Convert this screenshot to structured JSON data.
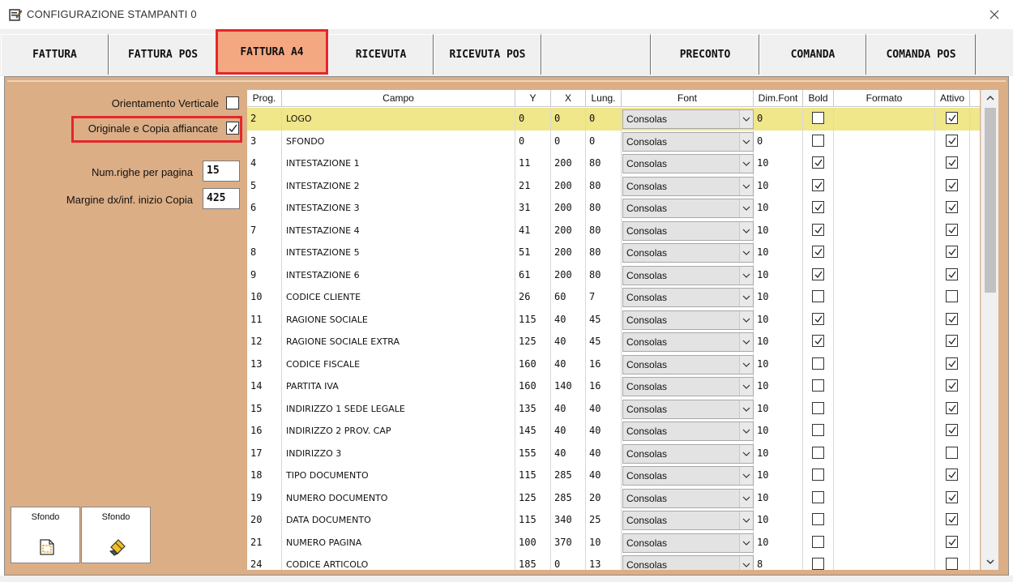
{
  "window": {
    "title": "CONFIGURAZIONE STAMPANTI 0"
  },
  "tabs": [
    {
      "label": "FATTURA"
    },
    {
      "label": "FATTURA POS"
    },
    {
      "label": "FATTURA A4",
      "active": true
    },
    {
      "label": "RICEVUTA"
    },
    {
      "label": "RICEVUTA POS"
    },
    {
      "label": ""
    },
    {
      "label": "PRECONTO"
    },
    {
      "label": "COMANDA"
    },
    {
      "label": "COMANDA POS"
    }
  ],
  "options": {
    "orientamento_label": "Orientamento Verticale",
    "orientamento_checked": false,
    "affiancate_label": "Originale e Copia affiancate",
    "affiancate_checked": true,
    "righe_label": "Num.righe per pagina",
    "righe_value": "15",
    "margine_label": "Margine dx/inf. inizio Copia",
    "margine_value": "425"
  },
  "buttons": {
    "sfondo1_label": "Sfondo",
    "sfondo2_label": "Sfondo"
  },
  "grid": {
    "headers": [
      "Prog.",
      "Campo",
      "Y",
      "X",
      "Lung.",
      "Font",
      "Dim.Font",
      "Bold",
      "Formato",
      "Attivo"
    ],
    "rows": [
      {
        "prog": "2",
        "campo": "LOGO",
        "y": "0",
        "x": "0",
        "lung": "0",
        "font": "Consolas",
        "dim": "0",
        "bold": false,
        "formato": "",
        "attivo": true,
        "selected": true
      },
      {
        "prog": "3",
        "campo": "SFONDO",
        "y": "0",
        "x": "0",
        "lung": "0",
        "font": "Consolas",
        "dim": "0",
        "bold": false,
        "formato": "",
        "attivo": true
      },
      {
        "prog": "4",
        "campo": "INTESTAZIONE 1",
        "y": "11",
        "x": "200",
        "lung": "80",
        "font": "Consolas",
        "dim": "10",
        "bold": true,
        "formato": "",
        "attivo": true
      },
      {
        "prog": "5",
        "campo": "INTESTAZIONE 2",
        "y": "21",
        "x": "200",
        "lung": "80",
        "font": "Consolas",
        "dim": "10",
        "bold": true,
        "formato": "",
        "attivo": true
      },
      {
        "prog": "6",
        "campo": "INTESTAZIONE 3",
        "y": "31",
        "x": "200",
        "lung": "80",
        "font": "Consolas",
        "dim": "10",
        "bold": true,
        "formato": "",
        "attivo": true
      },
      {
        "prog": "7",
        "campo": "INTESTAZIONE 4",
        "y": "41",
        "x": "200",
        "lung": "80",
        "font": "Consolas",
        "dim": "10",
        "bold": true,
        "formato": "",
        "attivo": true
      },
      {
        "prog": "8",
        "campo": "INTESTAZIONE 5",
        "y": "51",
        "x": "200",
        "lung": "80",
        "font": "Consolas",
        "dim": "10",
        "bold": true,
        "formato": "",
        "attivo": true
      },
      {
        "prog": "9",
        "campo": "INTESTAZIONE 6",
        "y": "61",
        "x": "200",
        "lung": "80",
        "font": "Consolas",
        "dim": "10",
        "bold": true,
        "formato": "",
        "attivo": true
      },
      {
        "prog": "10",
        "campo": "CODICE CLIENTE",
        "y": "26",
        "x": "60",
        "lung": "7",
        "font": "Consolas",
        "dim": "10",
        "bold": false,
        "formato": "",
        "attivo": false
      },
      {
        "prog": "11",
        "campo": "RAGIONE SOCIALE",
        "y": "115",
        "x": "40",
        "lung": "45",
        "font": "Consolas",
        "dim": "10",
        "bold": true,
        "formato": "",
        "attivo": true
      },
      {
        "prog": "12",
        "campo": "RAGIONE SOCIALE EXTRA",
        "y": "125",
        "x": "40",
        "lung": "45",
        "font": "Consolas",
        "dim": "10",
        "bold": true,
        "formato": "",
        "attivo": true
      },
      {
        "prog": "13",
        "campo": "CODICE FISCALE",
        "y": "160",
        "x": "40",
        "lung": "16",
        "font": "Consolas",
        "dim": "10",
        "bold": false,
        "formato": "",
        "attivo": true
      },
      {
        "prog": "14",
        "campo": "PARTITA IVA",
        "y": "160",
        "x": "140",
        "lung": "16",
        "font": "Consolas",
        "dim": "10",
        "bold": false,
        "formato": "",
        "attivo": true
      },
      {
        "prog": "15",
        "campo": "INDIRIZZO 1 SEDE LEGALE",
        "y": "135",
        "x": "40",
        "lung": "40",
        "font": "Consolas",
        "dim": "10",
        "bold": false,
        "formato": "",
        "attivo": true
      },
      {
        "prog": "16",
        "campo": "INDIRIZZO 2 PROV. CAP",
        "y": "145",
        "x": "40",
        "lung": "40",
        "font": "Consolas",
        "dim": "10",
        "bold": false,
        "formato": "",
        "attivo": true
      },
      {
        "prog": "17",
        "campo": "INDIRIZZO 3",
        "y": "155",
        "x": "40",
        "lung": "40",
        "font": "Consolas",
        "dim": "10",
        "bold": false,
        "formato": "",
        "attivo": false
      },
      {
        "prog": "18",
        "campo": "TIPO DOCUMENTO",
        "y": "115",
        "x": "285",
        "lung": "40",
        "font": "Consolas",
        "dim": "10",
        "bold": false,
        "formato": "",
        "attivo": true
      },
      {
        "prog": "19",
        "campo": "NUMERO DOCUMENTO",
        "y": "125",
        "x": "285",
        "lung": "20",
        "font": "Consolas",
        "dim": "10",
        "bold": false,
        "formato": "",
        "attivo": true
      },
      {
        "prog": "20",
        "campo": "DATA DOCUMENTO",
        "y": "115",
        "x": "340",
        "lung": "25",
        "font": "Consolas",
        "dim": "10",
        "bold": false,
        "formato": "",
        "attivo": true
      },
      {
        "prog": "21",
        "campo": "NUMERO PAGINA",
        "y": "100",
        "x": "370",
        "lung": "10",
        "font": "Consolas",
        "dim": "10",
        "bold": false,
        "formato": "",
        "attivo": true
      },
      {
        "prog": "24",
        "campo": "CODICE ARTICOLO",
        "y": "185",
        "x": "0",
        "lung": "13",
        "font": "Consolas",
        "dim": "8",
        "bold": false,
        "formato": "",
        "attivo": false
      }
    ]
  }
}
